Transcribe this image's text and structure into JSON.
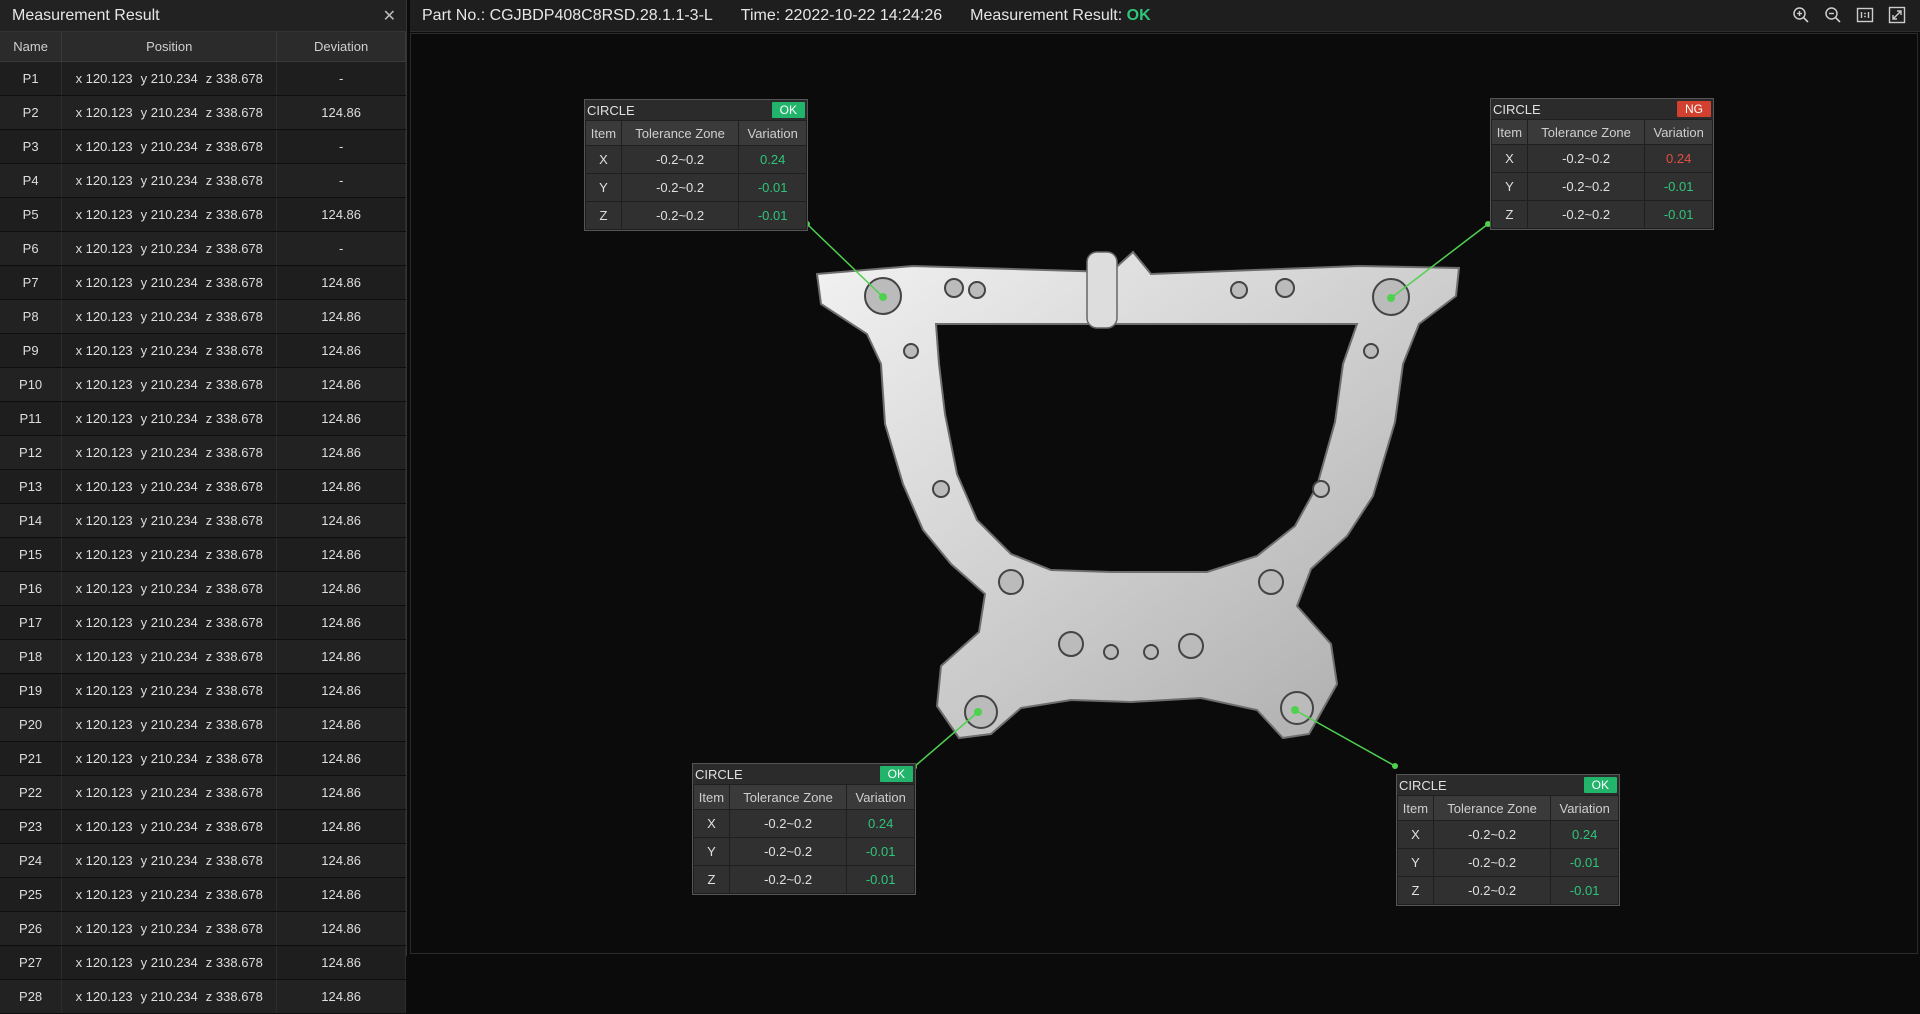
{
  "panel": {
    "title": "Measurement Result",
    "close_icon": "✕",
    "columns": [
      "Name",
      "Position",
      "Deviation"
    ],
    "rows": [
      {
        "name": "P1",
        "x": "x 120.123",
        "y": "y 210.234",
        "z": "z 338.678",
        "dev": "-"
      },
      {
        "name": "P2",
        "x": "x 120.123",
        "y": "y 210.234",
        "z": "z 338.678",
        "dev": "124.86"
      },
      {
        "name": "P3",
        "x": "x 120.123",
        "y": "y 210.234",
        "z": "z 338.678",
        "dev": "-"
      },
      {
        "name": "P4",
        "x": "x 120.123",
        "y": "y 210.234",
        "z": "z 338.678",
        "dev": "-"
      },
      {
        "name": "P5",
        "x": "x 120.123",
        "y": "y 210.234",
        "z": "z 338.678",
        "dev": "124.86"
      },
      {
        "name": "P6",
        "x": "x 120.123",
        "y": "y 210.234",
        "z": "z 338.678",
        "dev": "-"
      },
      {
        "name": "P7",
        "x": "x 120.123",
        "y": "y 210.234",
        "z": "z 338.678",
        "dev": "124.86"
      },
      {
        "name": "P8",
        "x": "x 120.123",
        "y": "y 210.234",
        "z": "z 338.678",
        "dev": "124.86"
      },
      {
        "name": "P9",
        "x": "x 120.123",
        "y": "y 210.234",
        "z": "z 338.678",
        "dev": "124.86"
      },
      {
        "name": "P10",
        "x": "x 120.123",
        "y": "y 210.234",
        "z": "z 338.678",
        "dev": "124.86"
      },
      {
        "name": "P11",
        "x": "x 120.123",
        "y": "y 210.234",
        "z": "z 338.678",
        "dev": "124.86"
      },
      {
        "name": "P12",
        "x": "x 120.123",
        "y": "y 210.234",
        "z": "z 338.678",
        "dev": "124.86"
      },
      {
        "name": "P13",
        "x": "x 120.123",
        "y": "y 210.234",
        "z": "z 338.678",
        "dev": "124.86"
      },
      {
        "name": "P14",
        "x": "x 120.123",
        "y": "y 210.234",
        "z": "z 338.678",
        "dev": "124.86"
      },
      {
        "name": "P15",
        "x": "x 120.123",
        "y": "y 210.234",
        "z": "z 338.678",
        "dev": "124.86"
      },
      {
        "name": "P16",
        "x": "x 120.123",
        "y": "y 210.234",
        "z": "z 338.678",
        "dev": "124.86"
      },
      {
        "name": "P17",
        "x": "x 120.123",
        "y": "y 210.234",
        "z": "z 338.678",
        "dev": "124.86"
      },
      {
        "name": "P18",
        "x": "x 120.123",
        "y": "y 210.234",
        "z": "z 338.678",
        "dev": "124.86"
      },
      {
        "name": "P19",
        "x": "x 120.123",
        "y": "y 210.234",
        "z": "z 338.678",
        "dev": "124.86"
      },
      {
        "name": "P20",
        "x": "x 120.123",
        "y": "y 210.234",
        "z": "z 338.678",
        "dev": "124.86"
      },
      {
        "name": "P21",
        "x": "x 120.123",
        "y": "y 210.234",
        "z": "z 338.678",
        "dev": "124.86"
      },
      {
        "name": "P22",
        "x": "x 120.123",
        "y": "y 210.234",
        "z": "z 338.678",
        "dev": "124.86"
      },
      {
        "name": "P23",
        "x": "x 120.123",
        "y": "y 210.234",
        "z": "z 338.678",
        "dev": "124.86"
      },
      {
        "name": "P24",
        "x": "x 120.123",
        "y": "y 210.234",
        "z": "z 338.678",
        "dev": "124.86"
      },
      {
        "name": "P25",
        "x": "x 120.123",
        "y": "y 210.234",
        "z": "z 338.678",
        "dev": "124.86"
      },
      {
        "name": "P26",
        "x": "x 120.123",
        "y": "y 210.234",
        "z": "z 338.678",
        "dev": "124.86"
      },
      {
        "name": "P27",
        "x": "x 120.123",
        "y": "y 210.234",
        "z": "z 338.678",
        "dev": "124.86"
      },
      {
        "name": "P28",
        "x": "x 120.123",
        "y": "y 210.234",
        "z": "z 338.678",
        "dev": "124.86"
      }
    ]
  },
  "topbar": {
    "part_no": "Part No.: CGJBDP408C8RSD.28.1.1-3-L",
    "time": "Time: 22022-10-22  14:24:26",
    "result_label": "Measurement Result: ",
    "result_value": "OK",
    "tools": [
      "zoom-in-icon",
      "zoom-out-icon",
      "actual-size-icon",
      "fit-screen-icon"
    ]
  },
  "colors": {
    "ok": "#23b46b",
    "ng": "#d2402f",
    "leader": "#4fd14f"
  },
  "cards": [
    {
      "id": "tl",
      "title": "CIRCLE",
      "status": "OK",
      "status_class": "ok",
      "headers": [
        "Item",
        "Tolerance Zone",
        "Variation"
      ],
      "rows": [
        {
          "item": "X",
          "tol": "-0.2~0.2",
          "var": "0.24",
          "c": "green"
        },
        {
          "item": "Y",
          "tol": "-0.2~0.2",
          "var": "-0.01",
          "c": "green"
        },
        {
          "item": "Z",
          "tol": "-0.2~0.2",
          "var": "-0.01",
          "c": "green"
        }
      ]
    },
    {
      "id": "tr",
      "title": "CIRCLE",
      "status": "NG",
      "status_class": "ng",
      "headers": [
        "Item",
        "Tolerance Zone",
        "Variation"
      ],
      "rows": [
        {
          "item": "X",
          "tol": "-0.2~0.2",
          "var": "0.24",
          "c": "red"
        },
        {
          "item": "Y",
          "tol": "-0.2~0.2",
          "var": "-0.01",
          "c": "green"
        },
        {
          "item": "Z",
          "tol": "-0.2~0.2",
          "var": "-0.01",
          "c": "green"
        }
      ]
    },
    {
      "id": "bl",
      "title": "CIRCLE",
      "status": "OK",
      "status_class": "ok",
      "headers": [
        "Item",
        "Tolerance Zone",
        "Variation"
      ],
      "rows": [
        {
          "item": "X",
          "tol": "-0.2~0.2",
          "var": "0.24",
          "c": "green"
        },
        {
          "item": "Y",
          "tol": "-0.2~0.2",
          "var": "-0.01",
          "c": "green"
        },
        {
          "item": "Z",
          "tol": "-0.2~0.2",
          "var": "-0.01",
          "c": "green"
        }
      ]
    },
    {
      "id": "br",
      "title": "CIRCLE",
      "status": "OK",
      "status_class": "ok",
      "headers": [
        "Item",
        "Tolerance Zone",
        "Variation"
      ],
      "rows": [
        {
          "item": "X",
          "tol": "-0.2~0.2",
          "var": "0.24",
          "c": "green"
        },
        {
          "item": "Y",
          "tol": "-0.2~0.2",
          "var": "-0.01",
          "c": "green"
        },
        {
          "item": "Z",
          "tol": "-0.2~0.2",
          "var": "-0.01",
          "c": "green"
        }
      ]
    }
  ]
}
